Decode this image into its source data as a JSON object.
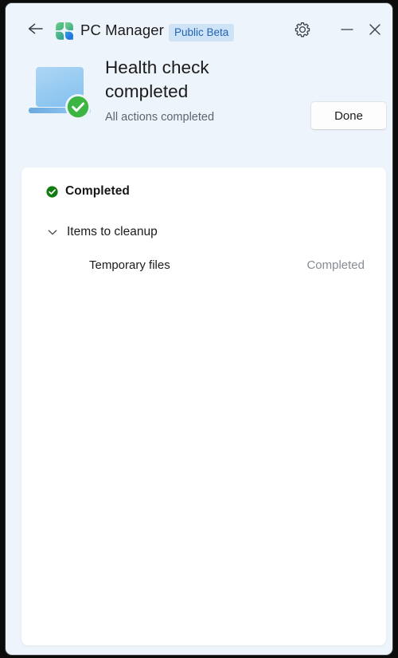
{
  "window": {
    "background_color": "#eef4fb",
    "card_background_color": "#ffffff"
  },
  "titlebar": {
    "back_label": "Back",
    "app_name": "PC Manager",
    "badge_label": "Public Beta",
    "badge_bg_color": "#cfe3f7",
    "badge_text_color": "#2064b4",
    "settings_label": "Settings",
    "minimize_label": "Minimize",
    "close_label": "Close"
  },
  "hero": {
    "title": "Health check completed",
    "subtitle": "All actions completed",
    "done_label": "Done",
    "icon_name": "laptop-with-check-icon",
    "check_color": "#3cb543"
  },
  "results": {
    "section": {
      "label": "Completed",
      "badge_color": "#107c10"
    },
    "group": {
      "label": "Items to cleanup",
      "expanded": true
    },
    "items": [
      {
        "name": "Temporary files",
        "status": "Completed"
      }
    ]
  }
}
